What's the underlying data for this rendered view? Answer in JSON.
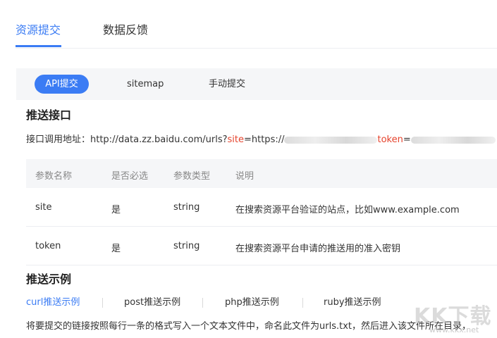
{
  "top_tabs": [
    {
      "label": "资源提交",
      "active": true
    },
    {
      "label": "数据反馈",
      "active": false
    }
  ],
  "sub_tabs": [
    {
      "label": "API提交",
      "active": true
    },
    {
      "label": "sitemap",
      "active": false
    },
    {
      "label": "手动提交",
      "active": false
    }
  ],
  "push_api": {
    "title": "推送接口",
    "endpoint_prefix": "接口调用地址：http://data.zz.baidu.com/urls?",
    "site_key": "site",
    "site_eq": "=https://",
    "token_key": "token",
    "token_eq": "="
  },
  "table": {
    "headers": [
      "参数名称",
      "是否必选",
      "参数类型",
      "说明"
    ],
    "rows": [
      [
        "site",
        "是",
        "string",
        "在搜索资源平台验证的站点，比如www.example.com"
      ],
      [
        "token",
        "是",
        "string",
        "在搜索资源平台申请的推送用的准入密钥"
      ]
    ]
  },
  "examples": {
    "title": "推送示例",
    "tabs": [
      {
        "label": "curl推送示例",
        "active": true
      },
      {
        "label": "post推送示例",
        "active": false
      },
      {
        "label": "php推送示例",
        "active": false
      },
      {
        "label": "ruby推送示例",
        "active": false
      }
    ],
    "description": "将要提交的链接按照每行一条的格式写入一个文本文件中，命名此文件为urls.txt，然后进入该文件所在目录，"
  },
  "watermark": {
    "main": "KK下载",
    "sub": "www.kkx.net"
  },
  "colors": {
    "accent": "#3b7cf4",
    "param_red": "#e5432d",
    "panel_bg": "#f5f6f8"
  }
}
